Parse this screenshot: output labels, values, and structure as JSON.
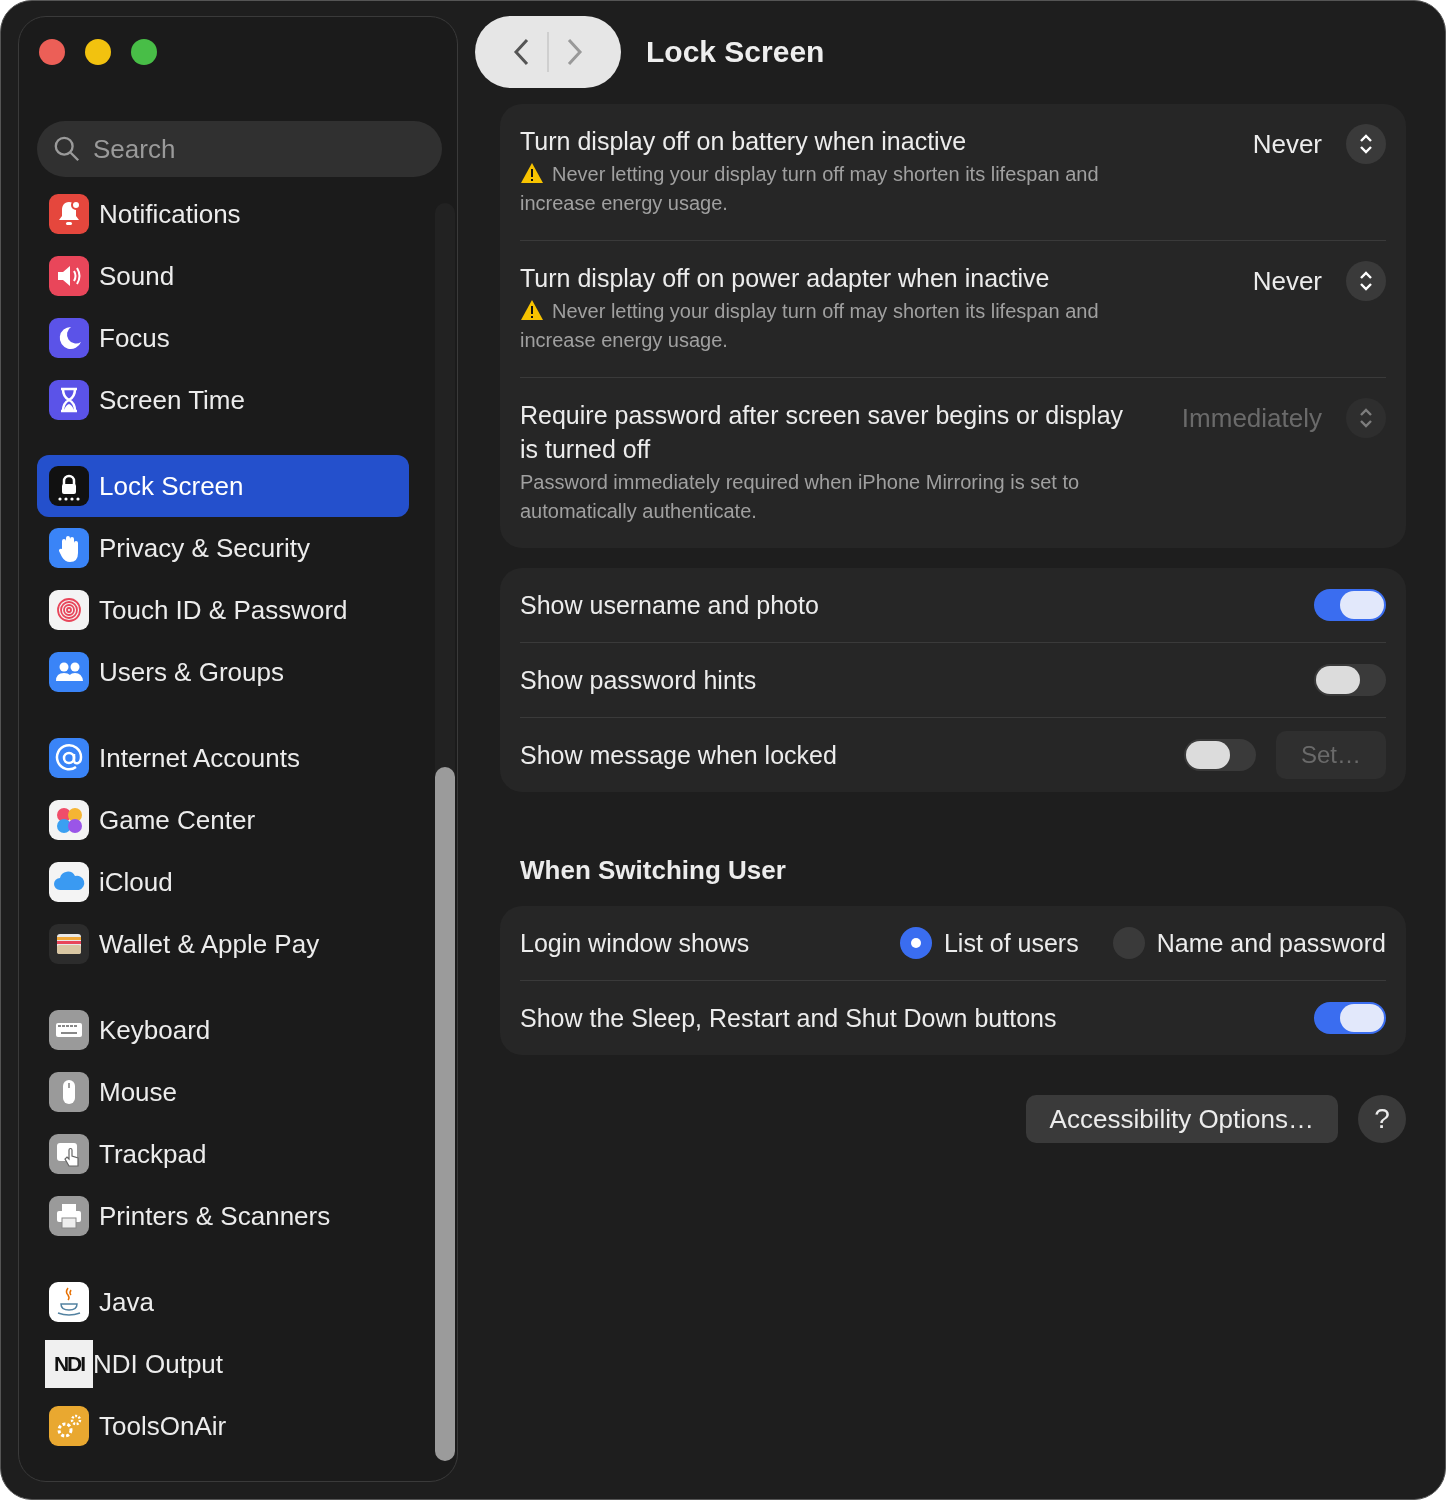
{
  "window": {
    "title": "Lock Screen"
  },
  "sidebar": {
    "search": {
      "placeholder": "Search"
    },
    "groups": [
      {
        "items": [
          {
            "label": "Notifications",
            "selected": false
          },
          {
            "label": "Sound",
            "selected": false
          },
          {
            "label": "Focus",
            "selected": false
          },
          {
            "label": "Screen Time",
            "selected": false
          }
        ]
      },
      {
        "items": [
          {
            "label": "Lock Screen",
            "selected": true
          },
          {
            "label": "Privacy & Security",
            "selected": false
          },
          {
            "label": "Touch ID & Password",
            "selected": false
          },
          {
            "label": "Users & Groups",
            "selected": false
          }
        ]
      },
      {
        "items": [
          {
            "label": "Internet Accounts",
            "selected": false
          },
          {
            "label": "Game Center",
            "selected": false
          },
          {
            "label": "iCloud",
            "selected": false
          },
          {
            "label": "Wallet & Apple Pay",
            "selected": false
          }
        ]
      },
      {
        "items": [
          {
            "label": "Keyboard",
            "selected": false
          },
          {
            "label": "Mouse",
            "selected": false
          },
          {
            "label": "Trackpad",
            "selected": false
          },
          {
            "label": "Printers & Scanners",
            "selected": false
          }
        ]
      },
      {
        "items": [
          {
            "label": "Java",
            "selected": false
          },
          {
            "label": "NDI Output",
            "selected": false,
            "logo_text": "NDI"
          },
          {
            "label": "ToolsOnAir",
            "selected": false
          }
        ]
      }
    ]
  },
  "display_settings": [
    {
      "title": "Turn display off on battery when inactive",
      "warning": true,
      "description": "Never letting your display turn off may shorten its lifespan and increase energy usage.",
      "value": "Never",
      "disabled": false
    },
    {
      "title": "Turn display off on power adapter when inactive",
      "warning": true,
      "description": "Never letting your display turn off may shorten its lifespan and increase energy usage.",
      "value": "Never",
      "disabled": false
    },
    {
      "title": "Require password after screen saver begins or display is turned off",
      "warning": false,
      "description": "Password immediately required when iPhone Mirroring is set to automatically authenticate.",
      "value": "Immediately",
      "disabled": true
    }
  ],
  "lock_options": [
    {
      "label": "Show username and photo",
      "on": true
    },
    {
      "label": "Show password hints",
      "on": false
    },
    {
      "label": "Show message when locked",
      "on": false,
      "button": {
        "label": "Set…",
        "disabled": true
      }
    }
  ],
  "switching_user": {
    "heading": "When Switching User",
    "rows": [
      {
        "kind": "radio",
        "label": "Login window shows",
        "options": [
          {
            "label": "List of users",
            "selected": true
          },
          {
            "label": "Name and password",
            "selected": false
          }
        ]
      },
      {
        "kind": "toggle",
        "label": "Show the Sleep, Restart and Shut Down buttons",
        "on": true
      }
    ]
  },
  "footer": {
    "button": "Accessibility Options…",
    "help": "?"
  }
}
